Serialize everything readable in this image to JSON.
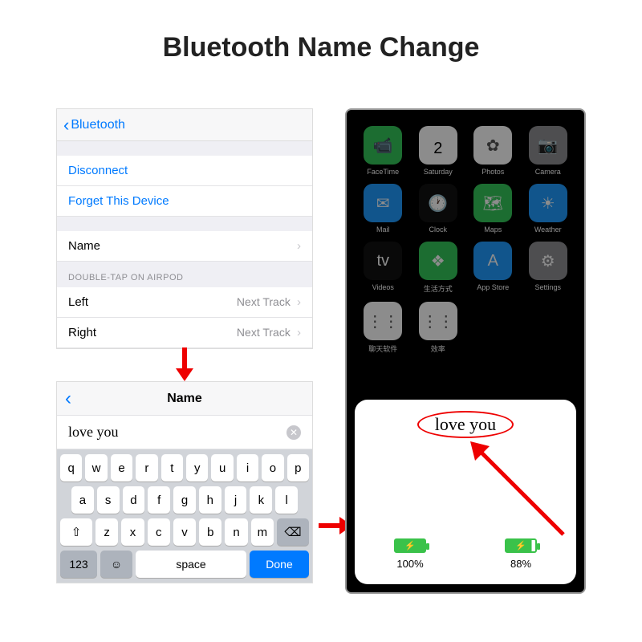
{
  "title": "Bluetooth Name Change",
  "settings": {
    "back_label": "Bluetooth",
    "disconnect": "Disconnect",
    "forget": "Forget This Device",
    "name_label": "Name",
    "double_tap_header": "DOUBLE-TAP ON AIRPOD",
    "left_label": "Left",
    "left_value": "Next Track",
    "right_label": "Right",
    "right_value": "Next Track"
  },
  "name_editor": {
    "title": "Name",
    "value": "love you"
  },
  "keyboard": {
    "row1": [
      "q",
      "w",
      "e",
      "r",
      "t",
      "y",
      "u",
      "i",
      "o",
      "p"
    ],
    "row2": [
      "a",
      "s",
      "d",
      "f",
      "g",
      "h",
      "j",
      "k",
      "l"
    ],
    "row3": [
      "z",
      "x",
      "c",
      "v",
      "b",
      "n",
      "m"
    ],
    "num": "123",
    "space": "space",
    "done": "Done"
  },
  "home_apps": [
    {
      "label": "FaceTime",
      "bg": "#34c759",
      "glyph": "📹"
    },
    {
      "label": "Saturday",
      "bg": "#ffffff",
      "glyph": "2",
      "cal": true,
      "dow": "Saturday"
    },
    {
      "label": "Photos",
      "bg": "#ffffff",
      "glyph": "✿"
    },
    {
      "label": "Camera",
      "bg": "#8e8e93",
      "glyph": "📷"
    },
    {
      "label": "Mail",
      "bg": "#1f9bff",
      "glyph": "✉︎"
    },
    {
      "label": "Clock",
      "bg": "#111",
      "glyph": "🕐"
    },
    {
      "label": "Maps",
      "bg": "#34c759",
      "glyph": "🗺"
    },
    {
      "label": "Weather",
      "bg": "#1f9bff",
      "glyph": "☀︎"
    },
    {
      "label": "Videos",
      "bg": "#111",
      "glyph": "tv"
    },
    {
      "label": "生活方式",
      "bg": "#34c759",
      "glyph": "❖"
    },
    {
      "label": "App Store",
      "bg": "#1f9bff",
      "glyph": "A"
    },
    {
      "label": "Settings",
      "bg": "#8e8e93",
      "glyph": "⚙︎"
    },
    {
      "label": "聊天软件",
      "bg": "#fff",
      "glyph": "⋮⋮"
    },
    {
      "label": "效率",
      "bg": "#fff",
      "glyph": "⋮⋮"
    }
  ],
  "popup": {
    "device_name": "love you",
    "batt_left": "100%",
    "batt_left_p": "100%",
    "batt_right": "88%",
    "batt_right_p": "88%"
  }
}
